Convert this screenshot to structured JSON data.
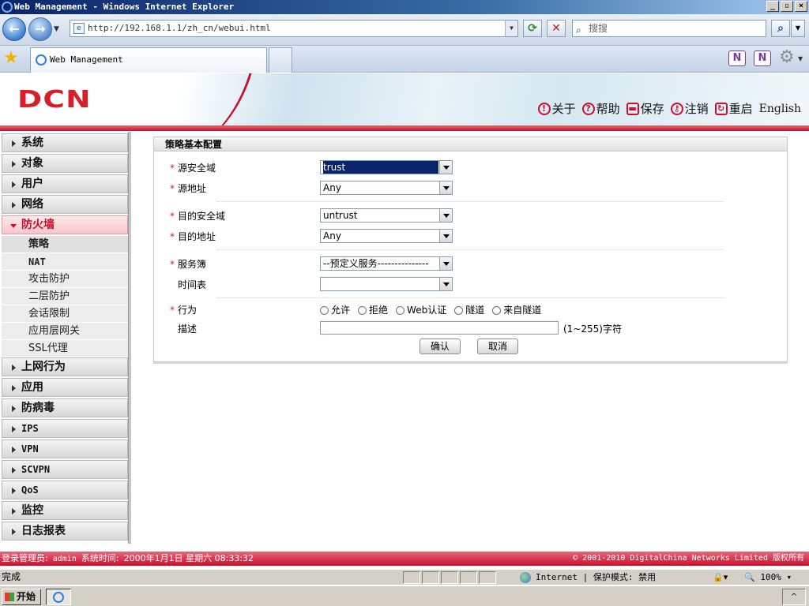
{
  "window": {
    "title": "Web Management - Windows Internet Explorer",
    "controls": [
      "_",
      "▫",
      "×"
    ]
  },
  "browser": {
    "address": "http://192.168.1.1/zh_cn/webui.html",
    "search_placeholder": "搜搜",
    "tab_title": "Web Management"
  },
  "header": {
    "logo": "DCN",
    "links": [
      {
        "label": "关于",
        "icon": "info-icon"
      },
      {
        "label": "帮助",
        "icon": "help-icon"
      },
      {
        "label": "保存",
        "icon": "save-icon"
      },
      {
        "label": "注销",
        "icon": "key-icon"
      },
      {
        "label": "重启",
        "icon": "restart-icon"
      }
    ],
    "english": "English"
  },
  "sidebar": {
    "items": [
      {
        "label": "系统"
      },
      {
        "label": "对象"
      },
      {
        "label": "用户"
      },
      {
        "label": "网络"
      },
      {
        "label": "防火墙",
        "active": true
      }
    ],
    "sub_items": [
      {
        "label": "策略"
      },
      {
        "label": "NAT"
      },
      {
        "label": "攻击防护"
      },
      {
        "label": "二层防护"
      },
      {
        "label": "会话限制"
      },
      {
        "label": "应用层网关"
      },
      {
        "label": "SSL代理"
      }
    ],
    "items_after": [
      {
        "label": "上网行为"
      },
      {
        "label": "应用"
      },
      {
        "label": "防病毒"
      },
      {
        "label": "IPS"
      },
      {
        "label": "VPN"
      },
      {
        "label": "SCVPN"
      },
      {
        "label": "QoS"
      },
      {
        "label": "监控"
      },
      {
        "label": "日志报表"
      }
    ]
  },
  "form": {
    "title": "策略基本配置",
    "required_mark": "*",
    "src_zone_label": "源安全域",
    "src_zone_value": "trust",
    "src_addr_label": "源地址",
    "src_addr_value": "Any",
    "dst_zone_label": "目的安全域",
    "dst_zone_value": "untrust",
    "dst_addr_label": "目的地址",
    "dst_addr_value": "Any",
    "service_label": "服务簿",
    "service_value": "--预定义服务---------------",
    "schedule_label": "时间表",
    "schedule_value": "",
    "action_label": "行为",
    "actions": [
      "允许",
      "拒绝",
      "Web认证",
      "隧道",
      "来自隧道"
    ],
    "desc_label": "描述",
    "desc_hint": "(1~255)字符",
    "confirm_label": "确认",
    "cancel_label": "取消"
  },
  "statusbar": {
    "admin_label": "登录管理员:",
    "admin_user": "admin",
    "time_label": "系统时间:",
    "time_value": "2000年1月1日 星期六 08:33:32",
    "copyright": "© 2001-2010 DigitalChina Networks Limited 版权所有"
  },
  "ie_status": {
    "done": "完成",
    "zone": "Internet | 保护模式: 禁用",
    "zoom": "100%"
  },
  "taskbar": {
    "start": "开始"
  }
}
